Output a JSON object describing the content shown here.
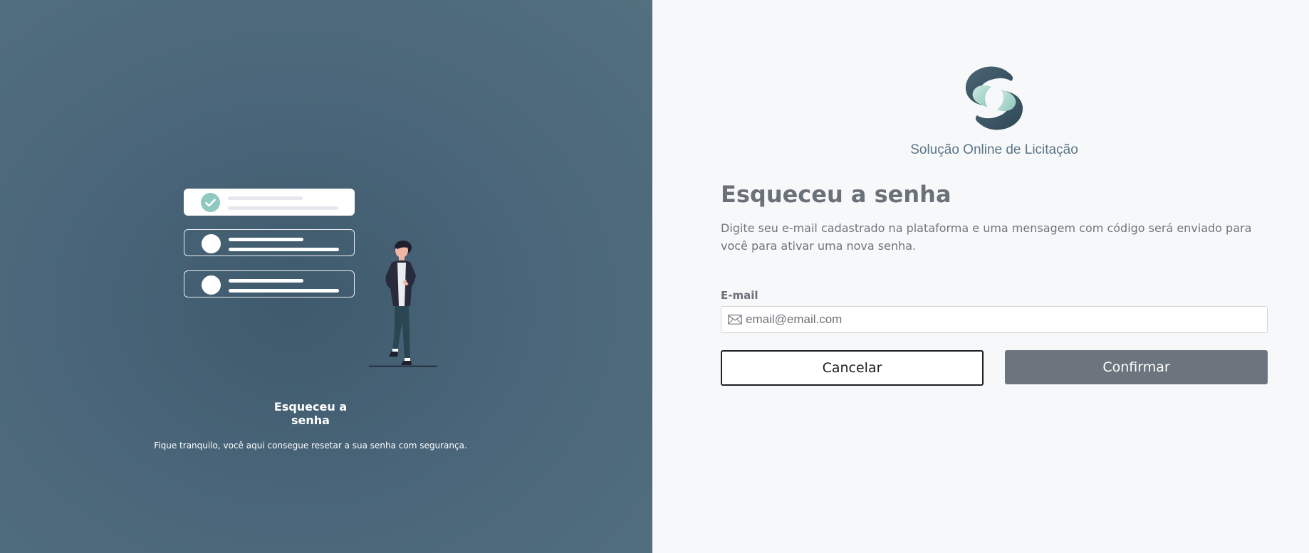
{
  "left": {
    "title": "Esqueceu a senha",
    "subtitle": "Fique tranquilo, você aqui consegue resetar a sua senha com segurança.",
    "illustration_icon": "checklist-person-illustration"
  },
  "brand": {
    "logo_icon": "s-swirl-logo",
    "name": "Solução Online de Licitação",
    "colors": {
      "dark": "#3f5a6a",
      "mint": "#a9d8cd",
      "left_panel": "#4a6579"
    }
  },
  "form": {
    "heading": "Esqueceu a senha",
    "description": "Digite seu e-mail cadastrado na plataforma e uma mensagem com código será enviado para você para ativar uma nova senha.",
    "email_label": "E-mail",
    "email_placeholder": "email@email.com",
    "email_value": "",
    "email_icon": "envelope-icon",
    "cancel_label": "Cancelar",
    "confirm_label": "Confirmar"
  }
}
